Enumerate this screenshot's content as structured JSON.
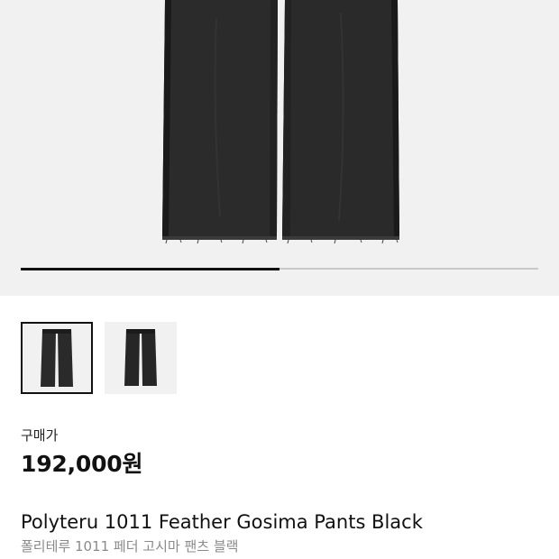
{
  "gallery": {
    "image_icon": "black-pants-photo",
    "progress_fraction": 0.5,
    "thumbnails": [
      {
        "icon": "pants-front-thumbnail",
        "selected": true
      },
      {
        "icon": "pants-back-thumbnail",
        "selected": false
      }
    ]
  },
  "price": {
    "label": "구매가",
    "value": "192,000원"
  },
  "product": {
    "name": "Polyteru 1011 Feather Gosima Pants Black",
    "name_ko": "폴리테루 1011 페더 고시마 팬츠 블랙"
  },
  "colors": {
    "background": "#ffffff",
    "image_bg": "#f1f1f1",
    "text_primary": "#111111",
    "text_secondary": "#8a8a8a",
    "pants": "#2a2a2a"
  }
}
